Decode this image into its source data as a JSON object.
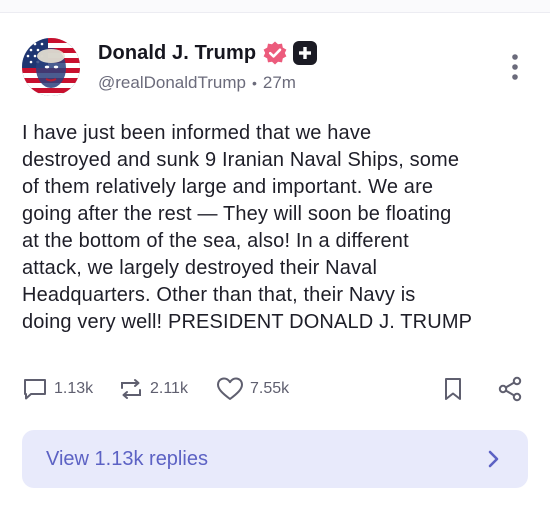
{
  "author": {
    "display_name": "Donald J. Trump",
    "handle": "@realDonaldTrump",
    "separator": "•",
    "time_ago": "27m",
    "avatar_icon": "avatar-flag-portrait",
    "verified_icon": "verified-badge-icon",
    "plus_icon": "plus-badge-icon"
  },
  "post": {
    "lines": [
      "I have just been informed that we have",
      "destroyed and sunk 9 Iranian Naval Ships, some",
      "of them relatively large and important. We are",
      "going after the rest — They will soon be floating",
      "at the bottom of the sea, also! In a different",
      "attack, we largely destroyed their Naval",
      "Headquarters. Other than that, their Navy is",
      "doing very well! PRESIDENT DONALD J. TRUMP"
    ]
  },
  "actions": {
    "replies_count": "1.13k",
    "reposts_count": "2.11k",
    "likes_count": "7.55k"
  },
  "view_replies": {
    "label": "View 1.13k replies"
  },
  "colors": {
    "verified": "#ec5b7c",
    "accent": "#5c62c4",
    "replies_bg": "#e8eafb",
    "muted": "#6b6b7b"
  }
}
